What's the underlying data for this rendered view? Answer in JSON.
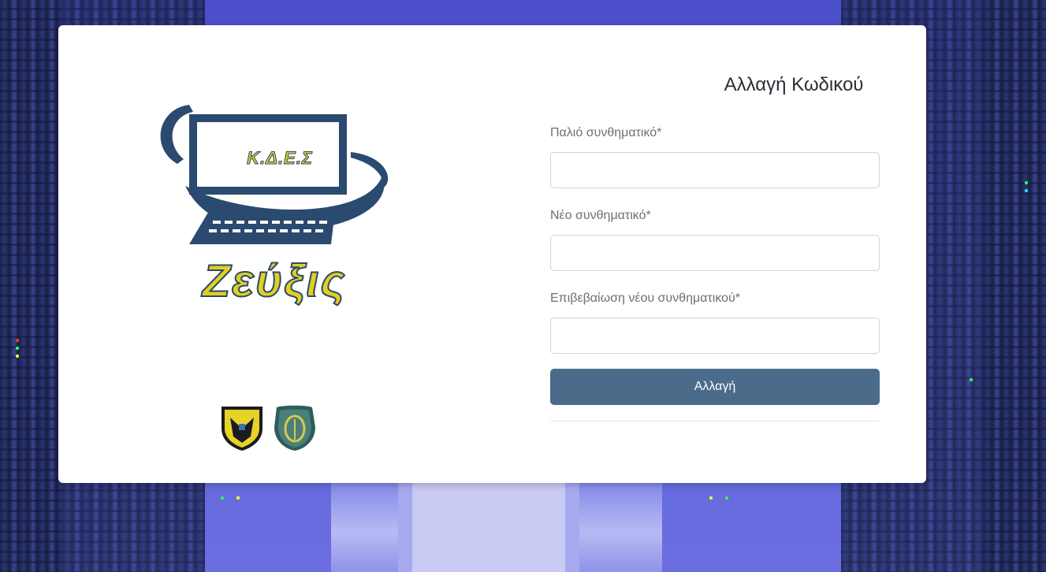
{
  "form": {
    "title": "Αλλαγή Κωδικού",
    "old_password_label": "Παλιό συνθηματικό*",
    "old_password_value": "",
    "new_password_label": "Νέο συνθηματικό*",
    "new_password_value": "",
    "confirm_password_label": "Επιβεβαίωση νέου συνθηματικού*",
    "confirm_password_value": "",
    "submit_label": "Αλλαγή"
  },
  "logo": {
    "acronym": "Κ.Δ.Ε.Σ",
    "name": "Ζεύξις"
  },
  "colors": {
    "primary_button": "#4a6b8a",
    "logo_navy": "#2b4a6f",
    "logo_yellow": "#e2cf1f",
    "background": "#5a5fd6"
  }
}
